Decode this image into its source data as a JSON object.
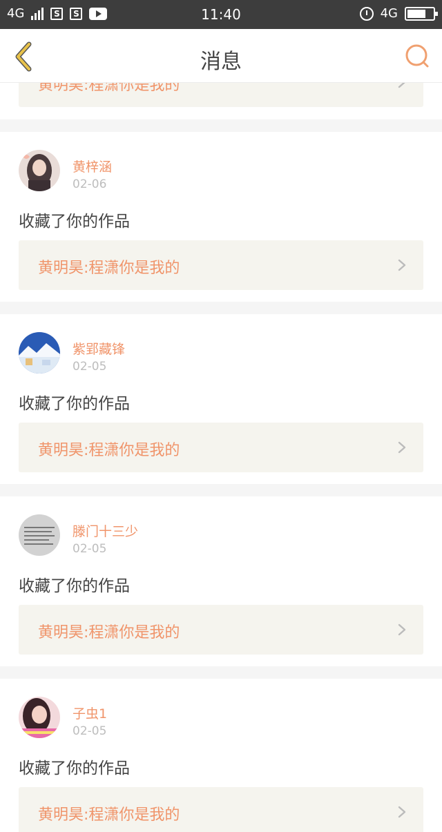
{
  "status_bar": {
    "network": "4G",
    "time": "11:40",
    "network_right": "4G",
    "s_icon_1": "S",
    "s_icon_2": "S"
  },
  "header": {
    "title": "消息"
  },
  "partial_item": {
    "work_title": "黄明昊:程潇你是我的"
  },
  "messages": [
    {
      "username": "黄梓涵",
      "date": "02-06",
      "action": "收藏了你的作品",
      "work_title": "黄明昊:程潇你是我的"
    },
    {
      "username": "紫郢藏锋",
      "date": "02-05",
      "action": "收藏了你的作品",
      "work_title": "黄明昊:程潇你是我的"
    },
    {
      "username": "滕门十三少",
      "date": "02-05",
      "action": "收藏了你的作品",
      "work_title": "黄明昊:程潇你是我的"
    },
    {
      "username": "子虫1",
      "date": "02-05",
      "action": "收藏了你的作品",
      "work_title": "黄明昊:程潇你是我的"
    }
  ],
  "colors": {
    "accent": "#f0946a",
    "back_icon": "#e8c24a",
    "search_icon": "#f0a070",
    "card_link_bg": "#f5f4ee"
  }
}
